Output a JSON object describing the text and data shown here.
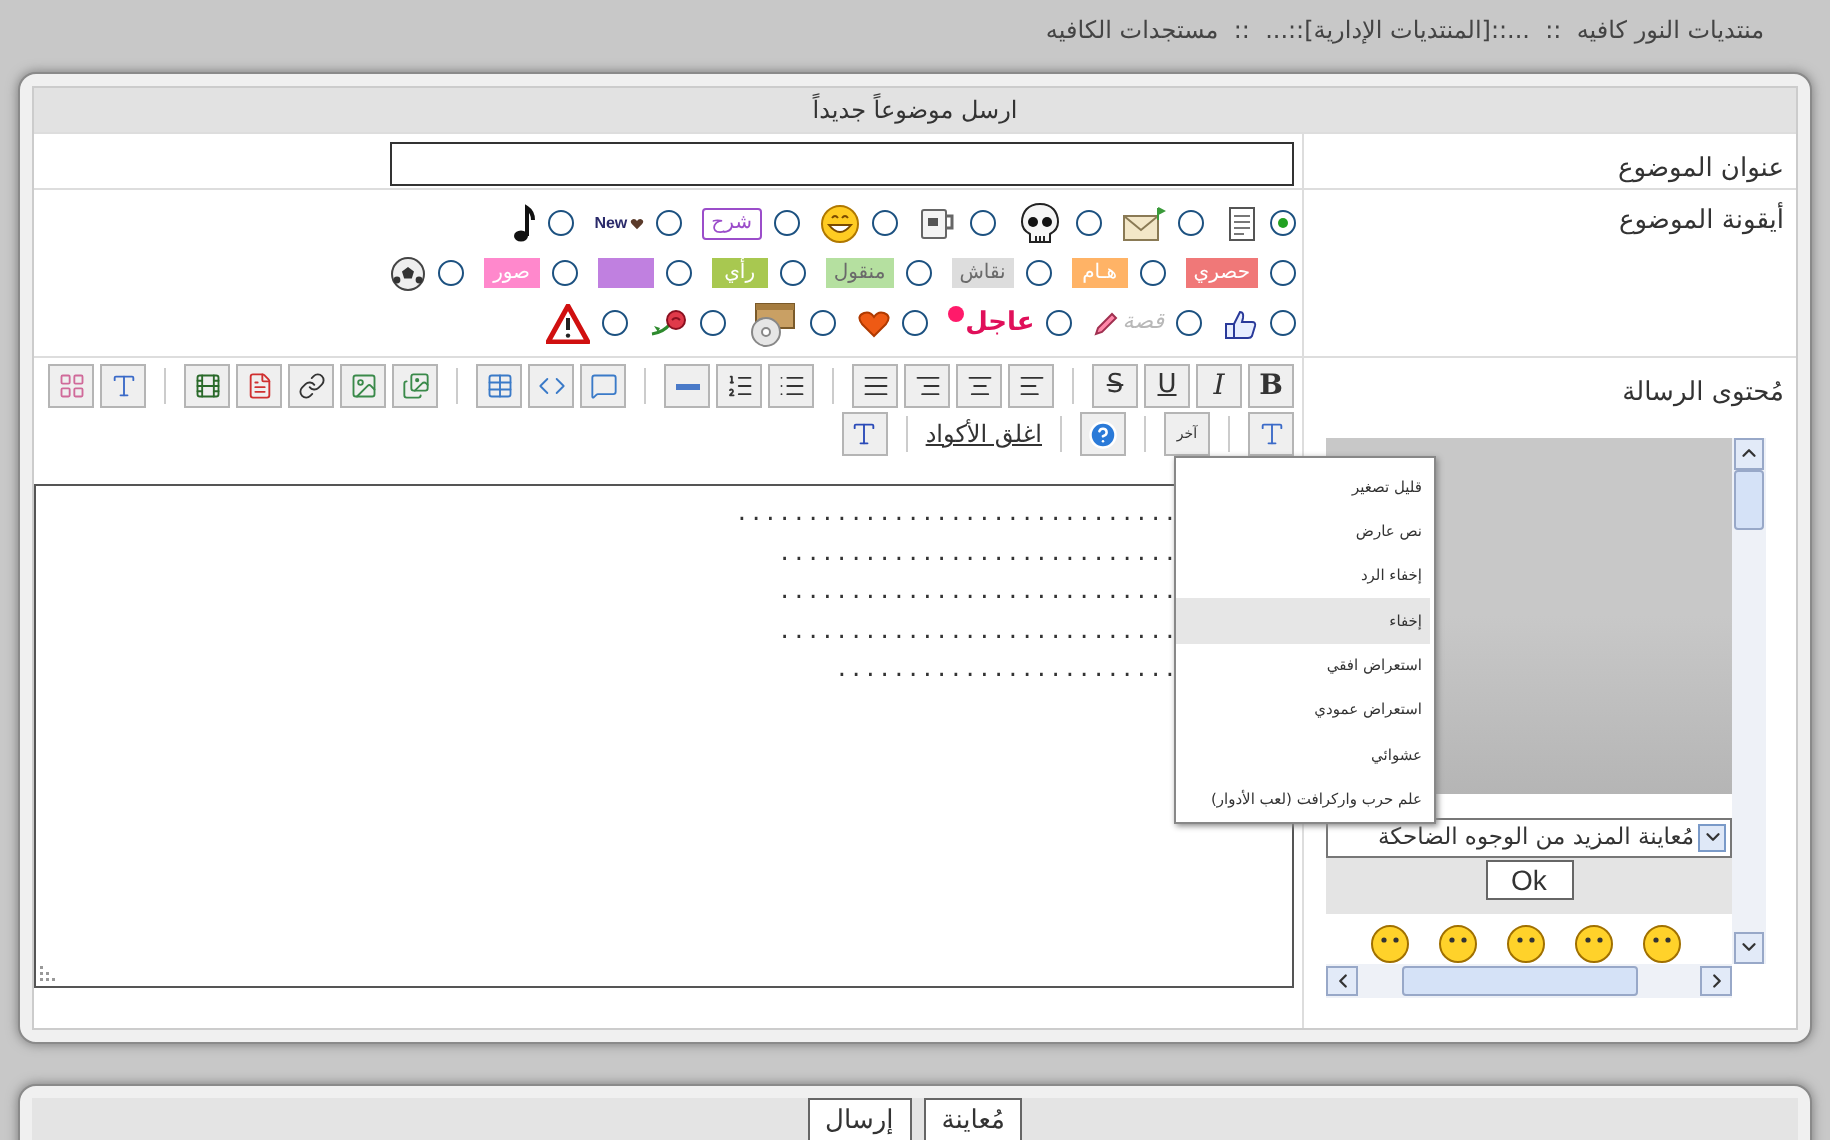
{
  "breadcrumb": "منتديات النور كافيه  ::  ...::[المنتديات الإدارية]::...  ::  مستجدات الكافيه",
  "form_title": "ارسل موضوعاً جديداً",
  "subject": {
    "label": "عنوان الموضوع"
  },
  "post_icon": {
    "label": "أيقونة الموضوع",
    "rows": [
      [
        {
          "kind": "document",
          "selected": true
        },
        {
          "kind": "mail",
          "selected": false
        },
        {
          "kind": "skull",
          "selected": false
        },
        {
          "kind": "mug",
          "selected": false
        },
        {
          "kind": "smiley",
          "selected": false
        },
        {
          "kind": "outline",
          "label": "شرح",
          "color": "#9b4dca",
          "selected": false
        },
        {
          "kind": "new",
          "label": "New",
          "selected": false
        },
        {
          "kind": "note",
          "selected": false
        }
      ],
      [
        {
          "kind": "tag",
          "label": "حصري",
          "color": "#f07878",
          "selected": false
        },
        {
          "kind": "tag",
          "label": "هـام",
          "color": "#ffb366",
          "selected": false
        },
        {
          "kind": "tag",
          "label": "نقاش",
          "color": "#dddddd",
          "selected": false
        },
        {
          "kind": "tag",
          "label": "منقول",
          "color": "#b5e0a0",
          "selected": false
        },
        {
          "kind": "tag",
          "label": "رأي",
          "color": "#a8c850",
          "selected": false
        },
        {
          "kind": "tag",
          "color": "#c080e0",
          "selected": false
        },
        {
          "kind": "tag",
          "label": "صور",
          "color": "#ff88cc",
          "selected": false
        },
        {
          "kind": "ball",
          "selected": false
        }
      ],
      [
        {
          "kind": "thumb",
          "selected": false
        },
        {
          "kind": "story",
          "label": "قصة",
          "selected": false
        },
        {
          "kind": "urgent",
          "label": "عاجل",
          "selected": false
        },
        {
          "kind": "heart",
          "selected": false
        },
        {
          "kind": "box",
          "selected": false
        },
        {
          "kind": "rose",
          "selected": false
        },
        {
          "kind": "warning",
          "selected": false
        }
      ]
    ]
  },
  "message": {
    "label": "مُحتوى الرسالة",
    "format_buttons": [
      "B",
      "I",
      "U",
      "S"
    ],
    "other_button": "آخر",
    "close_tags_link": "اغلق الأكواد",
    "body_lines": [
      "...............................",
      "............................",
      "............................",
      "............................",
      "........................"
    ],
    "menu": [
      {
        "label": "قليل تصغير",
        "selected": false
      },
      {
        "label": "نص عارض",
        "selected": false
      },
      {
        "label": "إخفاء الرد",
        "selected": false
      },
      {
        "label": "إخفاء",
        "selected": true
      },
      {
        "label": "استعراض افقي",
        "selected": false
      },
      {
        "label": "استعراض عمودي",
        "selected": false
      },
      {
        "label": "عشوائي",
        "selected": false
      },
      {
        "label": "علم حرب واركرافت (لعب الأدوار)",
        "selected": false
      }
    ],
    "smilies": {
      "select_value": "مُعاينة المزيد من الوجوه الضاحكة",
      "ok_button": "Ok"
    }
  },
  "actions": [
    "مُعاينة",
    "إرسال"
  ]
}
